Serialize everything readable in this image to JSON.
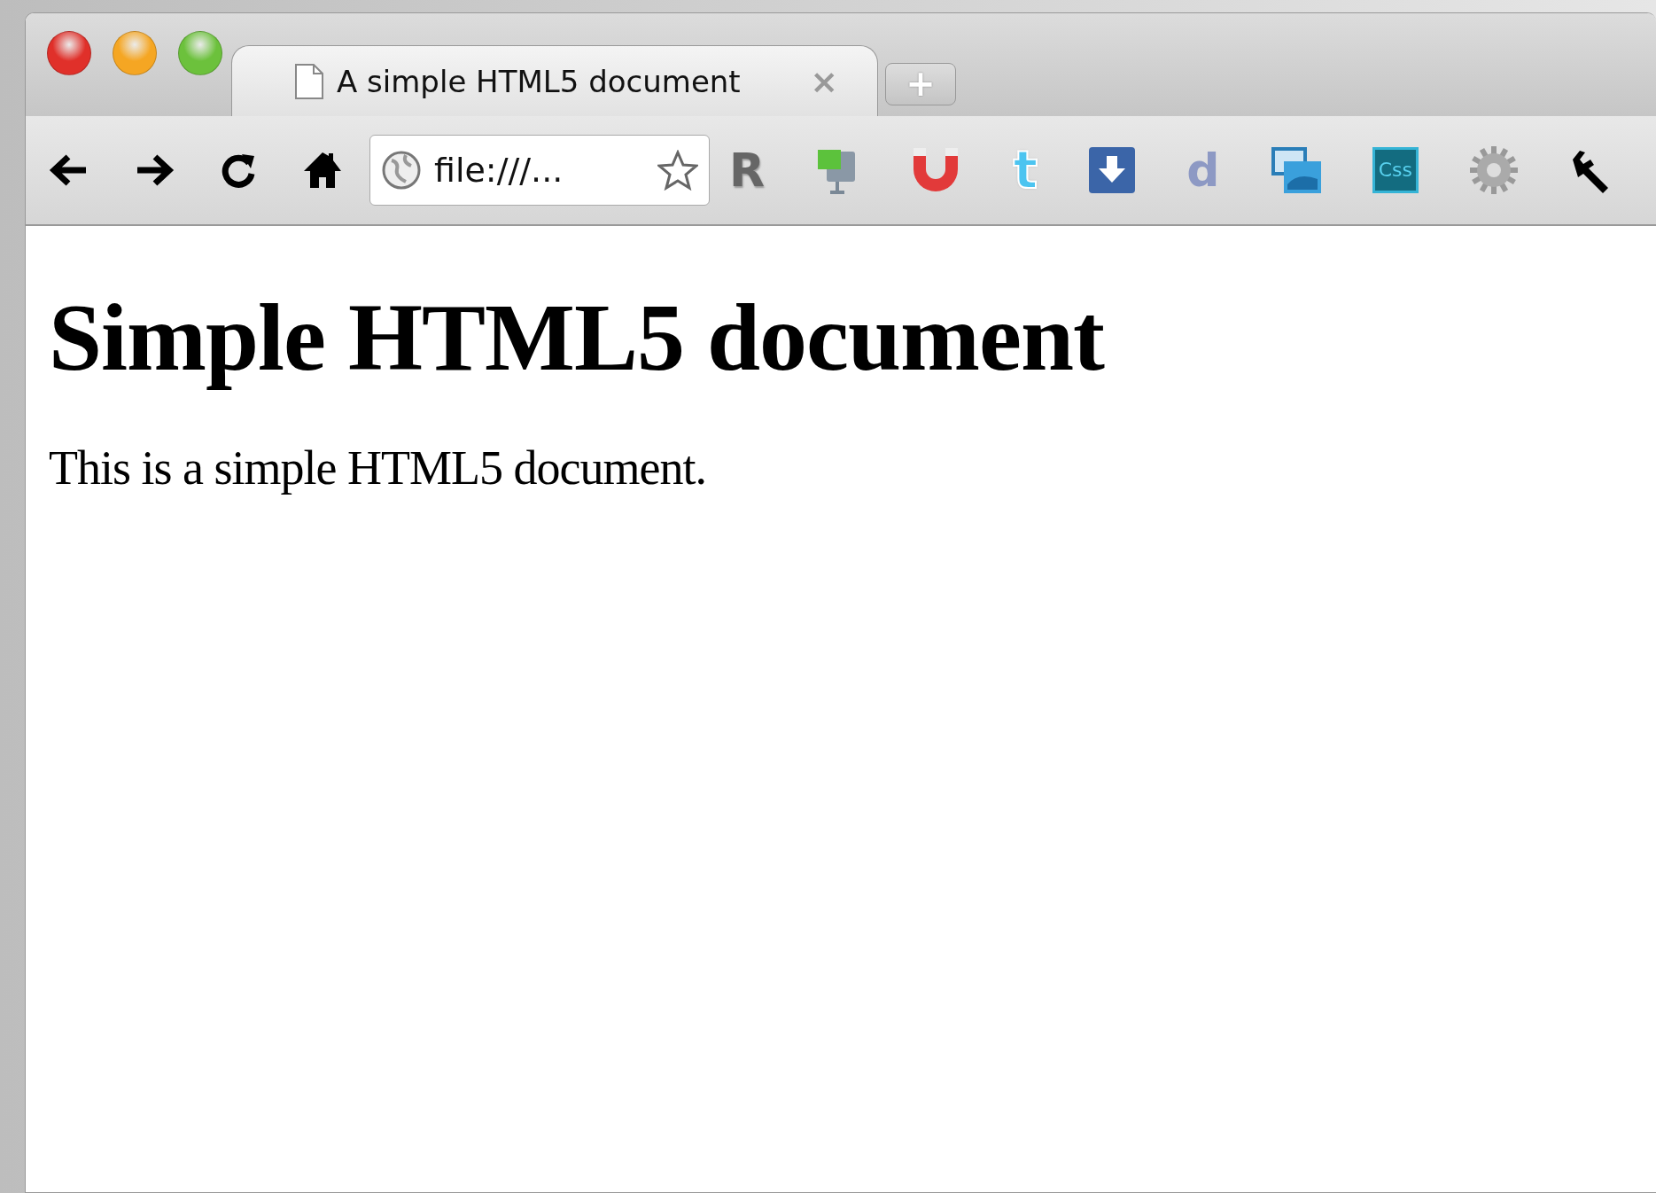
{
  "window": {
    "controls": [
      {
        "kind": "close"
      },
      {
        "kind": "minimize"
      },
      {
        "kind": "zoom"
      }
    ]
  },
  "tabs": [
    {
      "title": "A simple HTML5 document",
      "selected": true,
      "close": "×"
    }
  ],
  "new_tab": "+",
  "toolbar": {
    "address": "file:///..."
  },
  "extensions": [
    {
      "kind": "letter",
      "text": "R"
    },
    {
      "kind": "monitor"
    },
    {
      "kind": "magnet"
    },
    {
      "kind": "bird",
      "text": "t"
    },
    {
      "kind": "download"
    },
    {
      "kind": "faded-letter",
      "text": "d"
    },
    {
      "kind": "pictures"
    },
    {
      "kind": "css",
      "text": "Css"
    },
    {
      "kind": "gear"
    },
    {
      "kind": "wrench"
    }
  ],
  "page": {
    "heading": "Simple HTML5 document",
    "paragraph": "This is a simple HTML5 document."
  }
}
